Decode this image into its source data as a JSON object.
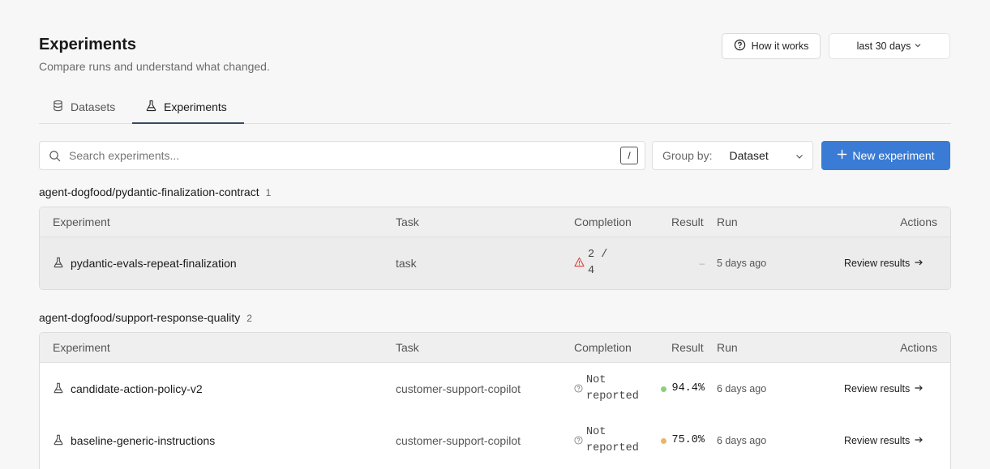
{
  "header": {
    "title": "Experiments",
    "subtitle": "Compare runs and understand what changed.",
    "how_it_works": "How it works",
    "date_range": "last 30 days"
  },
  "tabs": [
    {
      "label": "Datasets",
      "icon": "database-icon"
    },
    {
      "label": "Experiments",
      "icon": "flask-icon",
      "active": true
    }
  ],
  "toolbar": {
    "search_placeholder": "Search experiments...",
    "shortcut": "/",
    "group_by_label": "Group by:",
    "group_by_value": "Dataset",
    "new_experiment": "New experiment"
  },
  "columns": {
    "experiment": "Experiment",
    "task": "Task",
    "completion": "Completion",
    "result": "Result",
    "run": "Run",
    "actions": "Actions"
  },
  "groups": [
    {
      "name": "agent-dogfood/pydantic-finalization-contract",
      "count": "1",
      "rows": [
        {
          "experiment": "pydantic-evals-repeat-finalization",
          "task": "task",
          "completion_line1": "2 /",
          "completion_line2": "4",
          "completion_icon": "warning-icon",
          "result": "–",
          "run": "5 days ago",
          "action": "Review results"
        }
      ]
    },
    {
      "name": "agent-dogfood/support-response-quality",
      "count": "2",
      "rows": [
        {
          "experiment": "candidate-action-policy-v2",
          "task": "customer-support-copilot",
          "completion_line1": "Not",
          "completion_line2": "reported",
          "completion_icon": "help-circle-icon",
          "result": "94.4%",
          "result_color": "#8fce7a",
          "run": "6 days ago",
          "action": "Review results"
        },
        {
          "experiment": "baseline-generic-instructions",
          "task": "customer-support-copilot",
          "completion_line1": "Not",
          "completion_line2": "reported",
          "completion_icon": "help-circle-icon",
          "result": "75.0%",
          "result_color": "#e9b56a",
          "run": "6 days ago",
          "action": "Review results"
        }
      ]
    }
  ],
  "colors": {
    "accent": "#3a7bd5",
    "warning": "#d9453a"
  }
}
